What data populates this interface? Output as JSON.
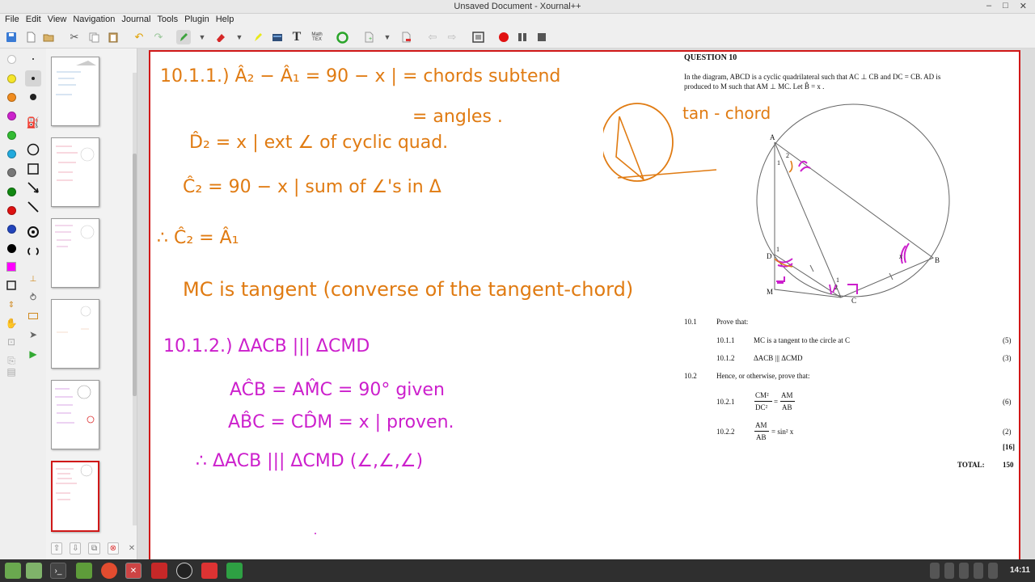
{
  "window": {
    "title": "Unsaved Document - Xournal++",
    "minimize": "–",
    "maximize": "□",
    "close": "✕"
  },
  "menu": [
    "File",
    "Edit",
    "View",
    "Navigation",
    "Journal",
    "Tools",
    "Plugin",
    "Help"
  ],
  "toolbar": {
    "mathtex_label": "Math TEX",
    "text_label": "T"
  },
  "colors": {
    "accent_ink_orange": "#e07b12",
    "accent_ink_magenta": "#cc1fcc",
    "page_border": "#d01818"
  },
  "palette": [
    "#ffffff",
    "#f5e52a",
    "#f08c1e",
    "#cc22cc",
    "#33bb33",
    "#22aadd",
    "#777777",
    "#118811",
    "#dd1111",
    "#2244bb",
    "#000000",
    "#ff00ff"
  ],
  "ink_orange": [
    "10.1.1.)  Â₂ − Â₁ = 90 − x  | = chords subtend",
    "= angles .",
    "D̂₂ = x  | ext ∠ of cyclic quad.",
    "Ĉ₂ = 90 − x | sum of ∠'s in Δ",
    "∴  Ĉ₂ = Â₁",
    "MC is tangent (converse of the tangent-chord)",
    "tan - chord"
  ],
  "ink_magenta": [
    "10.1.2.)  ΔACB ||| ΔCMD",
    "AĈB = AM̂C = 90° given",
    "AB̂C = CD̂M = x | proven.",
    "∴  ΔACB ||| ΔCMD  (∠,∠,∠)"
  ],
  "question": {
    "heading": "QUESTION 10",
    "intro1": "In the diagram,  ABCD  is a cyclic quadrilateral such that  AC ⊥ CB  and  DC = CB.  AD  is",
    "intro2": "produced to  M  such that  AM ⊥ MC.  Let  B̂ = x .",
    "labels": {
      "A": "A",
      "B": "B",
      "C": "C",
      "D": "D",
      "M": "M",
      "x": "x",
      "n1a": "1",
      "n2": "2",
      "n1b": "1",
      "n1c": "1",
      "n2b": "2"
    },
    "q101": "10.1",
    "q101_text": "Prove that:",
    "q1011": "10.1.1",
    "q1011_text": "MC  is a tangent to the circle at  C",
    "q1011_mark": "(5)",
    "q1012": "10.1.2",
    "q1012_text": "ΔACB ||| ΔCMD",
    "q1012_mark": "(3)",
    "q102": "10.2",
    "q102_text": "Hence, or otherwise, prove that:",
    "q1021": "10.2.1",
    "q1021_num": "CM²",
    "q1021_den": "DC²",
    "q1021_eq": "=",
    "q1021_num2": "AM",
    "q1021_den2": "AB",
    "q1021_mark": "(6)",
    "q1022": "10.2.2",
    "q1022_num": "AM",
    "q1022_den": "AB",
    "q1022_rhs": "= sin² x",
    "q1022_mark": "(2)",
    "subtotal": "[16]",
    "total_label": "TOTAL:",
    "total_value": "150"
  },
  "taskbar": {
    "clock": "14:11"
  }
}
